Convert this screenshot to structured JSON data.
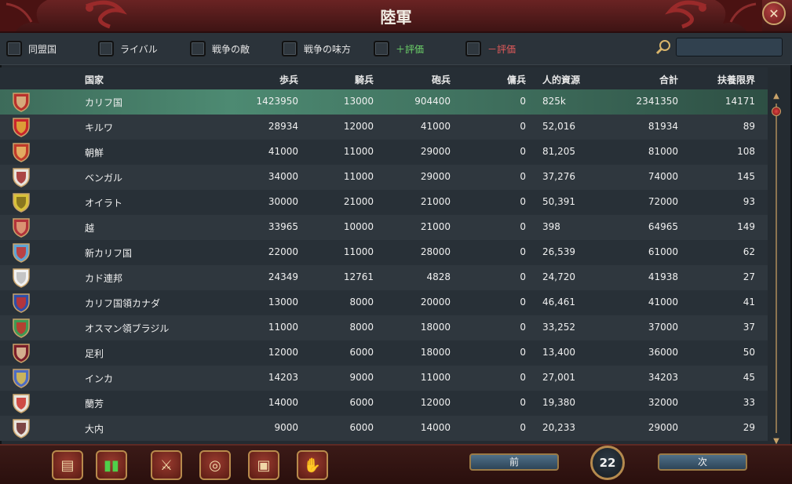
{
  "window": {
    "title": "陸軍"
  },
  "filters": [
    {
      "label": "同盟国"
    },
    {
      "label": "ライバル"
    },
    {
      "label": "戦争の敵"
    },
    {
      "label": "戦争の味方"
    },
    {
      "label": "＋評価"
    },
    {
      "label": "－評価"
    }
  ],
  "search": {
    "placeholder": ""
  },
  "columns": [
    "国家",
    "歩兵",
    "騎兵",
    "砲兵",
    "傭兵",
    "人的資源",
    "合計",
    "扶養限界"
  ],
  "rows": [
    {
      "country": "カリフ国",
      "infantry": "1423950",
      "cavalry": "13000",
      "artillery": "904400",
      "mercenaries": "0",
      "manpower": "825k",
      "total": "2341350",
      "forcelimit": "14171",
      "shield_colors": [
        "#b8312c",
        "#d9c089"
      ]
    },
    {
      "country": "キルワ",
      "infantry": "28934",
      "cavalry": "12000",
      "artillery": "41000",
      "mercenaries": "0",
      "manpower": "52,016",
      "total": "81934",
      "forcelimit": "89",
      "shield_colors": [
        "#c9252b",
        "#e0b23a"
      ]
    },
    {
      "country": "朝鮮",
      "infantry": "41000",
      "cavalry": "11000",
      "artillery": "29000",
      "mercenaries": "0",
      "manpower": "81,205",
      "total": "81000",
      "forcelimit": "108",
      "shield_colors": [
        "#c03a2a",
        "#e7c06b"
      ]
    },
    {
      "country": "ベンガル",
      "infantry": "34000",
      "cavalry": "11000",
      "artillery": "29000",
      "mercenaries": "0",
      "manpower": "37,276",
      "total": "74000",
      "forcelimit": "145",
      "shield_colors": [
        "#e8e4dc",
        "#a02a2a"
      ]
    },
    {
      "country": "オイラト",
      "infantry": "30000",
      "cavalry": "21000",
      "artillery": "21000",
      "mercenaries": "0",
      "manpower": "50,391",
      "total": "72000",
      "forcelimit": "93",
      "shield_colors": [
        "#d9c239",
        "#7b6a1b"
      ]
    },
    {
      "country": "越",
      "infantry": "33965",
      "cavalry": "10000",
      "artillery": "21000",
      "mercenaries": "0",
      "manpower": "398",
      "total": "64965",
      "forcelimit": "149",
      "shield_colors": [
        "#b2333a",
        "#e0a57c"
      ]
    },
    {
      "country": "新カリフ国",
      "infantry": "22000",
      "cavalry": "11000",
      "artillery": "28000",
      "mercenaries": "0",
      "manpower": "26,539",
      "total": "61000",
      "forcelimit": "62",
      "shield_colors": [
        "#5fa3d4",
        "#c9302c"
      ]
    },
    {
      "country": "カド連邦",
      "infantry": "24349",
      "cavalry": "12761",
      "artillery": "4828",
      "mercenaries": "0",
      "manpower": "24,720",
      "total": "41938",
      "forcelimit": "27",
      "shield_colors": [
        "#f2f2f2",
        "#bdbdbd"
      ]
    },
    {
      "country": "カリフ国領カナダ",
      "infantry": "13000",
      "cavalry": "8000",
      "artillery": "20000",
      "mercenaries": "0",
      "manpower": "46,461",
      "total": "41000",
      "forcelimit": "41",
      "shield_colors": [
        "#2f4fa8",
        "#c9302c"
      ]
    },
    {
      "country": "オスマン領ブラジル",
      "infantry": "11000",
      "cavalry": "8000",
      "artillery": "18000",
      "mercenaries": "0",
      "manpower": "33,252",
      "total": "37000",
      "forcelimit": "37",
      "shield_colors": [
        "#3f9a54",
        "#c9302c"
      ]
    },
    {
      "country": "足利",
      "infantry": "12000",
      "cavalry": "6000",
      "artillery": "18000",
      "mercenaries": "0",
      "manpower": "13,400",
      "total": "36000",
      "forcelimit": "50",
      "shield_colors": [
        "#7a1e2a",
        "#e4c9a0"
      ]
    },
    {
      "country": "インカ",
      "infantry": "14203",
      "cavalry": "9000",
      "artillery": "11000",
      "mercenaries": "0",
      "manpower": "27,001",
      "total": "34203",
      "forcelimit": "45",
      "shield_colors": [
        "#4d6cc4",
        "#e0c04a"
      ]
    },
    {
      "country": "蘭芳",
      "infantry": "14000",
      "cavalry": "6000",
      "artillery": "12000",
      "mercenaries": "0",
      "manpower": "19,380",
      "total": "32000",
      "forcelimit": "33",
      "shield_colors": [
        "#e8e4dc",
        "#c9302c"
      ]
    },
    {
      "country": "大内",
      "infantry": "9000",
      "cavalry": "6000",
      "artillery": "14000",
      "mercenaries": "0",
      "manpower": "20,233",
      "total": "29000",
      "forcelimit": "29",
      "shield_colors": [
        "#e8e4dc",
        "#6a2a2a"
      ]
    }
  ],
  "bottom_buttons": [
    {
      "icon": "ledger-icon"
    },
    {
      "icon": "flags-icon"
    },
    {
      "icon": "crossed-swords-icon"
    },
    {
      "icon": "coins-icon"
    },
    {
      "icon": "crate-icon"
    },
    {
      "icon": "handshake-icon"
    }
  ],
  "pager": {
    "prev_label": "前",
    "next_label": "次",
    "page": "22"
  },
  "colors": {
    "title_bar": "#5a1e1e",
    "selected_row": "#4d8a72",
    "gold_trim": "#b88a4c"
  }
}
